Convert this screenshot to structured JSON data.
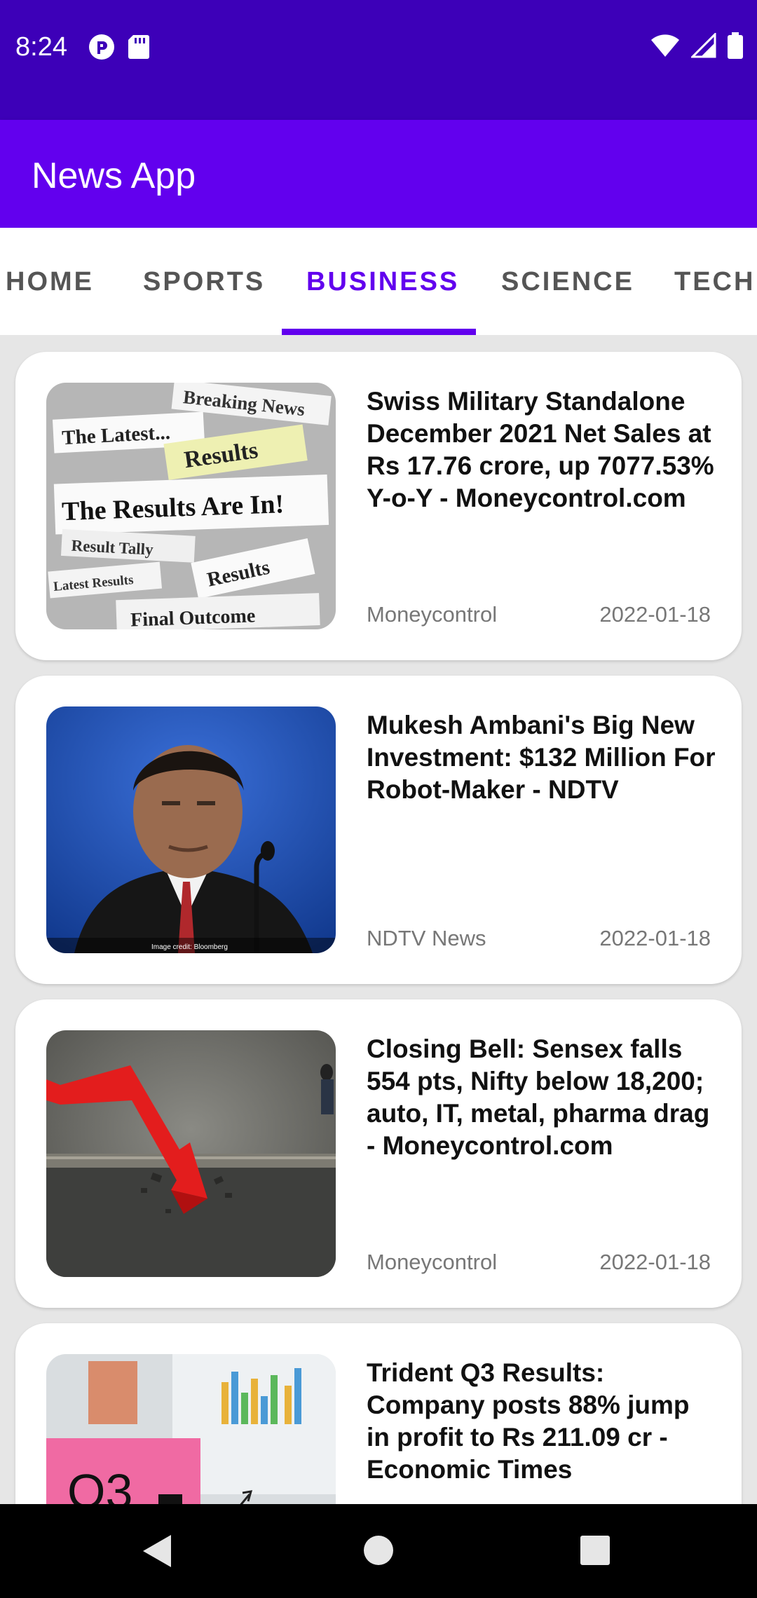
{
  "status_bar": {
    "time": "8:24",
    "left_icons": [
      "pocket-icon",
      "sd-card-icon"
    ],
    "right_icons": [
      "wifi-icon",
      "signal-icon",
      "battery-icon"
    ]
  },
  "app_bar": {
    "title": "News App",
    "color": "#6200ee"
  },
  "tabs": [
    {
      "label": "HOME",
      "active": false
    },
    {
      "label": "SPORTS",
      "active": false
    },
    {
      "label": "BUSINESS",
      "active": true
    },
    {
      "label": "SCIENCE",
      "active": false
    },
    {
      "label": "TECHNOLOGY",
      "active": false
    }
  ],
  "articles": [
    {
      "image": "results-newspaper-clippings",
      "image_texts": [
        "Breaking News",
        "The Latest...",
        "Results",
        "The Results Are In!",
        "Result Tally",
        "Latest Results",
        "Results",
        "Final Outcome"
      ],
      "headline": "Swiss Military Standalone December 2021 Net Sales at Rs 17.76 crore, up 7077.53% Y-o-Y - Moneycontrol.com",
      "source": "Moneycontrol",
      "date": "2022-01-18"
    },
    {
      "image": "man-at-microphone-photo",
      "image_credit": "Image credit: Bloomberg",
      "headline": "Mukesh Ambani's Big New Investment: $132 Million For Robot-Maker - NDTV",
      "source": "NDTV News",
      "date": "2022-01-18"
    },
    {
      "image": "red-arrow-crashing-wall",
      "headline": "Closing Bell: Sensex falls 554 pts, Nifty below 18,200; auto, IT, metal, pharma drag - Moneycontrol.com",
      "source": "Moneycontrol",
      "date": "2022-01-18"
    },
    {
      "image": "q3-sticky-note-charts",
      "image_texts": [
        "Q3"
      ],
      "headline": "Trident Q3 Results: Company posts 88% jump in profit to Rs 211.09 cr - Economic Times",
      "source": "",
      "date": ""
    }
  ],
  "nav_bar": {
    "icons": [
      "back-icon",
      "home-icon",
      "recents-icon"
    ]
  }
}
